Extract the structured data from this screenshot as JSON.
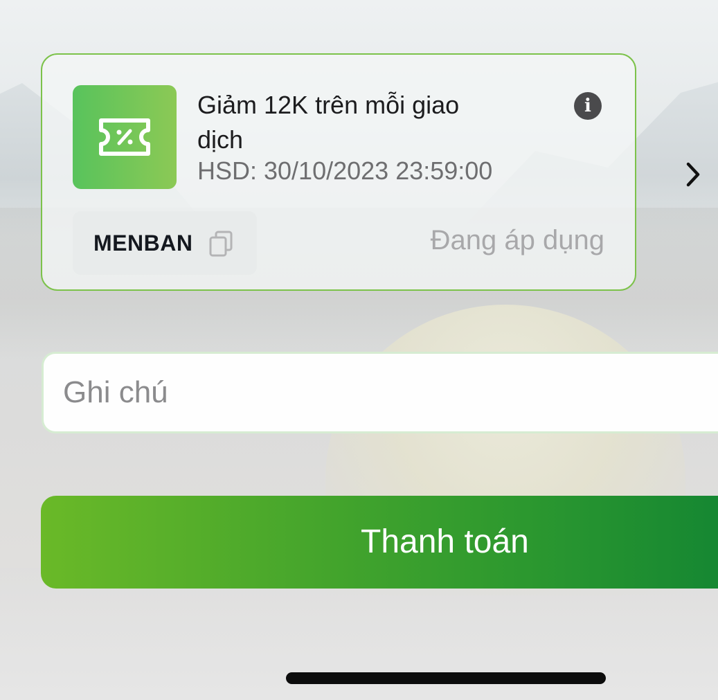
{
  "voucher": {
    "title": "Giảm 12K trên mỗi giao dịch",
    "expiry": "HSD: 30/10/2023 23:59:00",
    "code": "MENBAN",
    "status": "Đang áp dụng",
    "icon": "ticket-percent-icon",
    "accent_color": "#7cc24a"
  },
  "note": {
    "placeholder": "Ghi chú",
    "value": ""
  },
  "payment": {
    "button_label": "Thanh toán",
    "gradient_start": "#6ab928",
    "gradient_end": "#148632"
  }
}
